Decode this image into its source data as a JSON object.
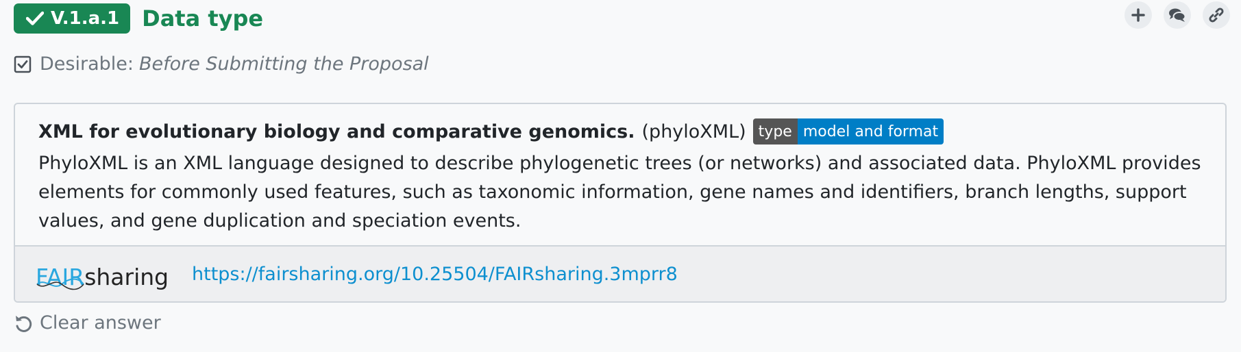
{
  "header": {
    "version": "V.1.a.1",
    "title": "Data type"
  },
  "actions": [
    {
      "name": "add",
      "icon": "plus-icon"
    },
    {
      "name": "comments",
      "icon": "comments-icon"
    },
    {
      "name": "link",
      "icon": "link-icon"
    }
  ],
  "requirement": {
    "level": "Desirable:",
    "phase": "Before Submitting the Proposal"
  },
  "card": {
    "name": "XML for evolutionary biology and comparative genomics.",
    "abbreviation": "(phyloXML)",
    "type_key": "type",
    "type_value": "model and format",
    "description": "PhyloXML is an XML language designed to describe phylogenetic trees (or networks) and associated data. PhyloXML provides elements for commonly used features, such as taxonomic information, gene names and identifiers, branch lengths, support values, and gene duplication and speciation events.",
    "logo_fair": "FAIR",
    "logo_sharing": "sharing",
    "link": "https://fairsharing.org/10.25504/FAIRsharing.3mprr8"
  },
  "clear_label": "Clear answer",
  "colors": {
    "accent": "#198754",
    "link": "#0d8fcf",
    "badge_key": "#555555",
    "badge_value": "#007ec6",
    "muted": "#6c757d"
  }
}
